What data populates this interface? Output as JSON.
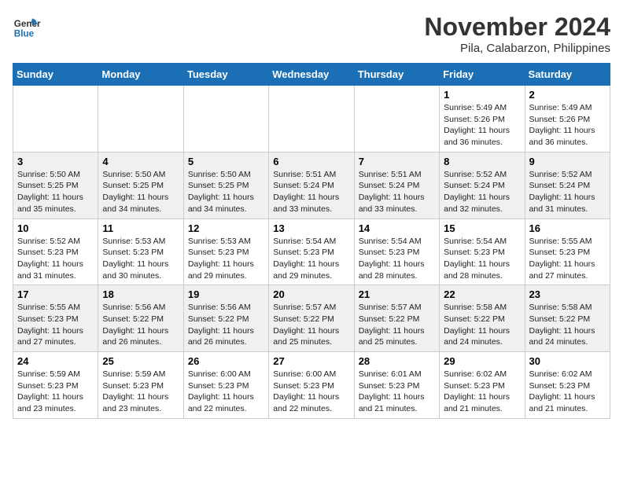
{
  "header": {
    "logo_line1": "General",
    "logo_line2": "Blue",
    "title": "November 2024",
    "subtitle": "Pila, Calabarzon, Philippines"
  },
  "weekdays": [
    "Sunday",
    "Monday",
    "Tuesday",
    "Wednesday",
    "Thursday",
    "Friday",
    "Saturday"
  ],
  "weeks": [
    [
      {
        "day": "",
        "info": ""
      },
      {
        "day": "",
        "info": ""
      },
      {
        "day": "",
        "info": ""
      },
      {
        "day": "",
        "info": ""
      },
      {
        "day": "",
        "info": ""
      },
      {
        "day": "1",
        "info": "Sunrise: 5:49 AM\nSunset: 5:26 PM\nDaylight: 11 hours\nand 36 minutes."
      },
      {
        "day": "2",
        "info": "Sunrise: 5:49 AM\nSunset: 5:26 PM\nDaylight: 11 hours\nand 36 minutes."
      }
    ],
    [
      {
        "day": "3",
        "info": "Sunrise: 5:50 AM\nSunset: 5:25 PM\nDaylight: 11 hours\nand 35 minutes."
      },
      {
        "day": "4",
        "info": "Sunrise: 5:50 AM\nSunset: 5:25 PM\nDaylight: 11 hours\nand 34 minutes."
      },
      {
        "day": "5",
        "info": "Sunrise: 5:50 AM\nSunset: 5:25 PM\nDaylight: 11 hours\nand 34 minutes."
      },
      {
        "day": "6",
        "info": "Sunrise: 5:51 AM\nSunset: 5:24 PM\nDaylight: 11 hours\nand 33 minutes."
      },
      {
        "day": "7",
        "info": "Sunrise: 5:51 AM\nSunset: 5:24 PM\nDaylight: 11 hours\nand 33 minutes."
      },
      {
        "day": "8",
        "info": "Sunrise: 5:52 AM\nSunset: 5:24 PM\nDaylight: 11 hours\nand 32 minutes."
      },
      {
        "day": "9",
        "info": "Sunrise: 5:52 AM\nSunset: 5:24 PM\nDaylight: 11 hours\nand 31 minutes."
      }
    ],
    [
      {
        "day": "10",
        "info": "Sunrise: 5:52 AM\nSunset: 5:23 PM\nDaylight: 11 hours\nand 31 minutes."
      },
      {
        "day": "11",
        "info": "Sunrise: 5:53 AM\nSunset: 5:23 PM\nDaylight: 11 hours\nand 30 minutes."
      },
      {
        "day": "12",
        "info": "Sunrise: 5:53 AM\nSunset: 5:23 PM\nDaylight: 11 hours\nand 29 minutes."
      },
      {
        "day": "13",
        "info": "Sunrise: 5:54 AM\nSunset: 5:23 PM\nDaylight: 11 hours\nand 29 minutes."
      },
      {
        "day": "14",
        "info": "Sunrise: 5:54 AM\nSunset: 5:23 PM\nDaylight: 11 hours\nand 28 minutes."
      },
      {
        "day": "15",
        "info": "Sunrise: 5:54 AM\nSunset: 5:23 PM\nDaylight: 11 hours\nand 28 minutes."
      },
      {
        "day": "16",
        "info": "Sunrise: 5:55 AM\nSunset: 5:23 PM\nDaylight: 11 hours\nand 27 minutes."
      }
    ],
    [
      {
        "day": "17",
        "info": "Sunrise: 5:55 AM\nSunset: 5:23 PM\nDaylight: 11 hours\nand 27 minutes."
      },
      {
        "day": "18",
        "info": "Sunrise: 5:56 AM\nSunset: 5:22 PM\nDaylight: 11 hours\nand 26 minutes."
      },
      {
        "day": "19",
        "info": "Sunrise: 5:56 AM\nSunset: 5:22 PM\nDaylight: 11 hours\nand 26 minutes."
      },
      {
        "day": "20",
        "info": "Sunrise: 5:57 AM\nSunset: 5:22 PM\nDaylight: 11 hours\nand 25 minutes."
      },
      {
        "day": "21",
        "info": "Sunrise: 5:57 AM\nSunset: 5:22 PM\nDaylight: 11 hours\nand 25 minutes."
      },
      {
        "day": "22",
        "info": "Sunrise: 5:58 AM\nSunset: 5:22 PM\nDaylight: 11 hours\nand 24 minutes."
      },
      {
        "day": "23",
        "info": "Sunrise: 5:58 AM\nSunset: 5:22 PM\nDaylight: 11 hours\nand 24 minutes."
      }
    ],
    [
      {
        "day": "24",
        "info": "Sunrise: 5:59 AM\nSunset: 5:23 PM\nDaylight: 11 hours\nand 23 minutes."
      },
      {
        "day": "25",
        "info": "Sunrise: 5:59 AM\nSunset: 5:23 PM\nDaylight: 11 hours\nand 23 minutes."
      },
      {
        "day": "26",
        "info": "Sunrise: 6:00 AM\nSunset: 5:23 PM\nDaylight: 11 hours\nand 22 minutes."
      },
      {
        "day": "27",
        "info": "Sunrise: 6:00 AM\nSunset: 5:23 PM\nDaylight: 11 hours\nand 22 minutes."
      },
      {
        "day": "28",
        "info": "Sunrise: 6:01 AM\nSunset: 5:23 PM\nDaylight: 11 hours\nand 21 minutes."
      },
      {
        "day": "29",
        "info": "Sunrise: 6:02 AM\nSunset: 5:23 PM\nDaylight: 11 hours\nand 21 minutes."
      },
      {
        "day": "30",
        "info": "Sunrise: 6:02 AM\nSunset: 5:23 PM\nDaylight: 11 hours\nand 21 minutes."
      }
    ]
  ]
}
